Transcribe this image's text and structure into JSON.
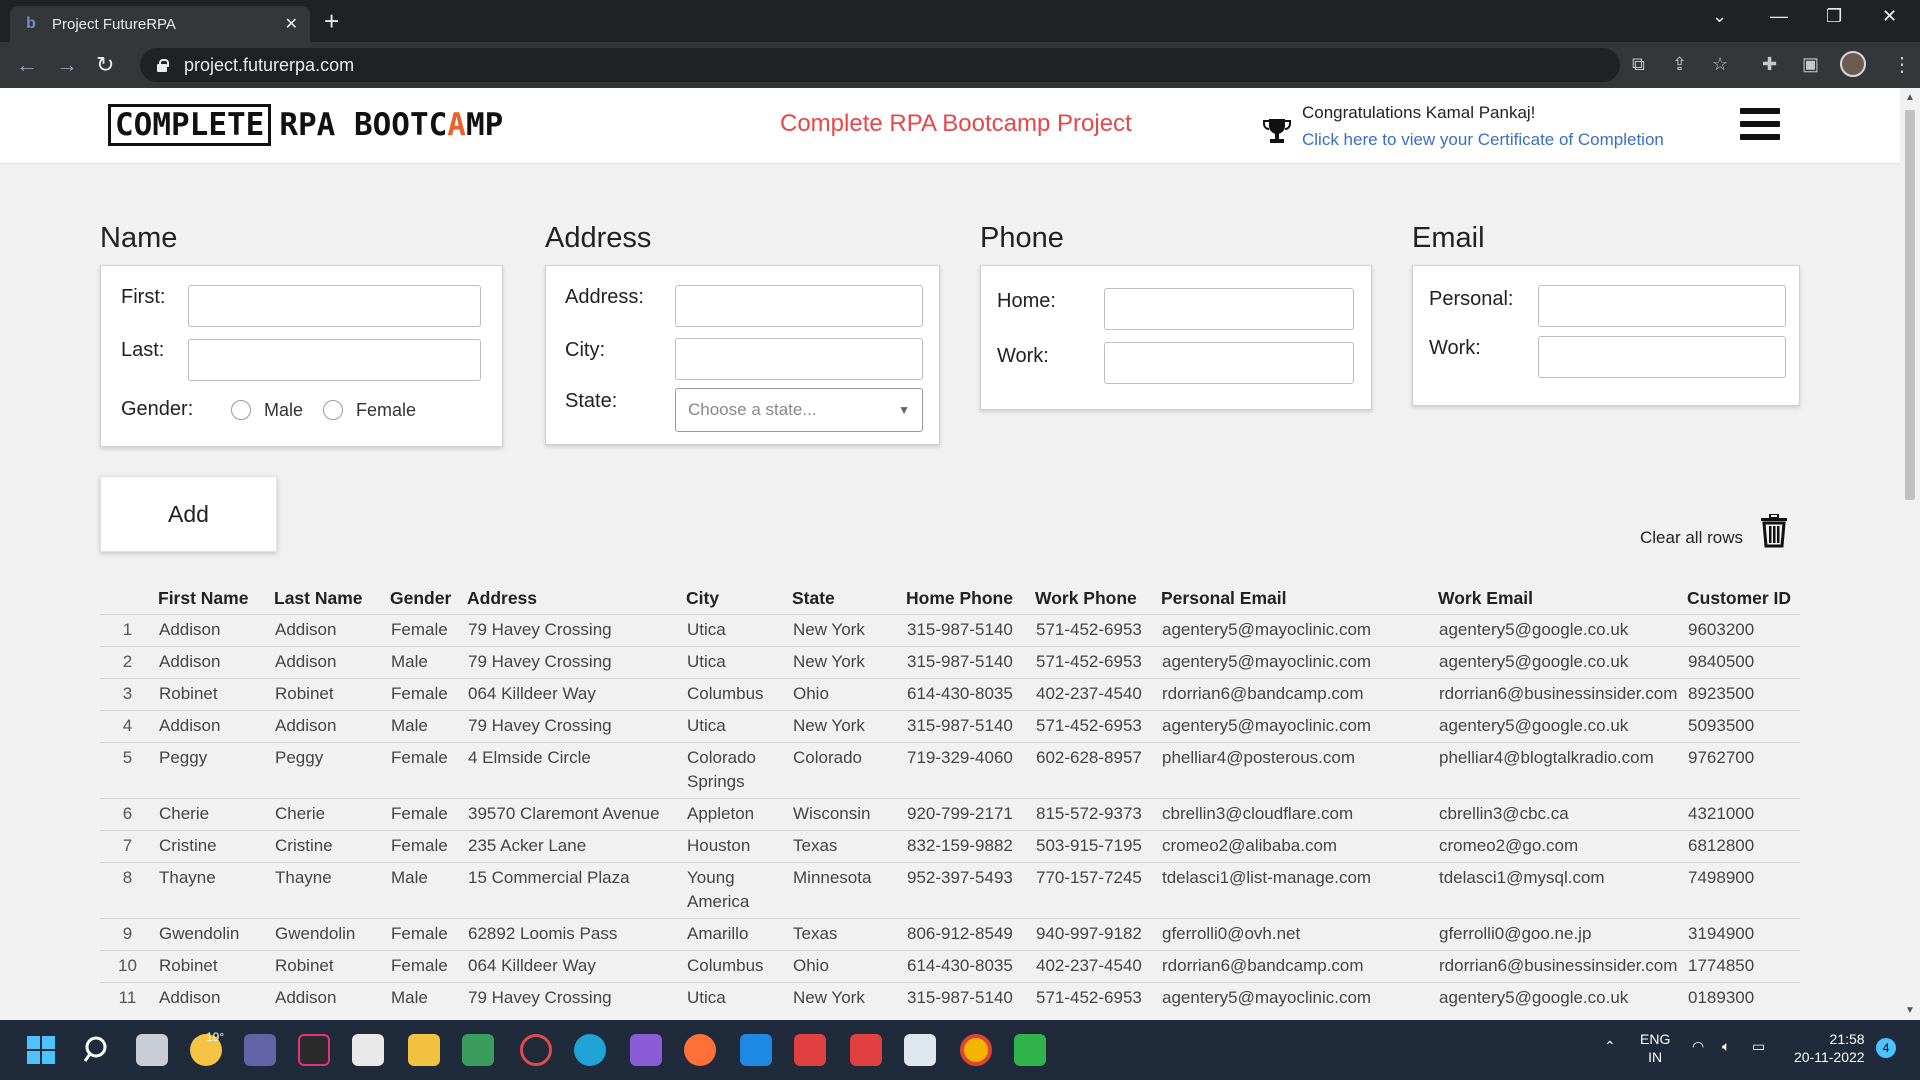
{
  "browser": {
    "tab_title": "Project FutureRPA",
    "url": "project.futurerpa.com"
  },
  "header": {
    "logo_boxed": "COMPLETE",
    "logo_rest_1": "RPA BOOTC",
    "logo_accent": "A",
    "logo_rest_2": "MP",
    "center_title": "Complete RPA Bootcamp Project",
    "congrats": "Congratulations Kamal Pankaj!",
    "cert_link": "Click here to view your Certificate of Completion"
  },
  "form": {
    "name": {
      "title": "Name",
      "first_label": "First:",
      "last_label": "Last:",
      "gender_label": "Gender:",
      "male_label": "Male",
      "female_label": "Female",
      "first_value": "",
      "last_value": ""
    },
    "address": {
      "title": "Address",
      "address_label": "Address:",
      "city_label": "City:",
      "state_label": "State:",
      "state_placeholder": "Choose a state...",
      "address_value": "",
      "city_value": ""
    },
    "phone": {
      "title": "Phone",
      "home_label": "Home:",
      "work_label": "Work:",
      "home_value": "",
      "work_value": ""
    },
    "email": {
      "title": "Email",
      "personal_label": "Personal:",
      "work_label": "Work:",
      "personal_value": "",
      "work_value": ""
    },
    "add_button": "Add",
    "clear_rows": "Clear all rows"
  },
  "table": {
    "columns": [
      "",
      "First Name",
      "Last Name",
      "Gender",
      "Address",
      "City",
      "State",
      "Home Phone",
      "Work Phone",
      "Personal Email",
      "Work Email",
      "Customer ID"
    ],
    "rows": [
      [
        "1",
        "Addison",
        "Addison",
        "Female",
        "79 Havey Crossing",
        "Utica",
        "New York",
        "315-987-5140",
        "571-452-6953",
        "agentery5@mayoclinic.com",
        "agentery5@google.co.uk",
        "9603200"
      ],
      [
        "2",
        "Addison",
        "Addison",
        "Male",
        "79 Havey Crossing",
        "Utica",
        "New York",
        "315-987-5140",
        "571-452-6953",
        "agentery5@mayoclinic.com",
        "agentery5@google.co.uk",
        "9840500"
      ],
      [
        "3",
        "Robinet",
        "Robinet",
        "Female",
        "064 Killdeer Way",
        "Columbus",
        "Ohio",
        "614-430-8035",
        "402-237-4540",
        "rdorrian6@bandcamp.com",
        "rdorrian6@businessinsider.com",
        "8923500"
      ],
      [
        "4",
        "Addison",
        "Addison",
        "Male",
        "79 Havey Crossing",
        "Utica",
        "New York",
        "315-987-5140",
        "571-452-6953",
        "agentery5@mayoclinic.com",
        "agentery5@google.co.uk",
        "5093500"
      ],
      [
        "5",
        "Peggy",
        "Peggy",
        "Female",
        "4 Elmside Circle",
        "Colorado Springs",
        "Colorado",
        "719-329-4060",
        "602-628-8957",
        "phelliar4@posterous.com",
        "phelliar4@blogtalkradio.com",
        "9762700"
      ],
      [
        "6",
        "Cherie",
        "Cherie",
        "Female",
        "39570 Claremont Avenue",
        "Appleton",
        "Wisconsin",
        "920-799-2171",
        "815-572-9373",
        "cbrellin3@cloudflare.com",
        "cbrellin3@cbc.ca",
        "4321000"
      ],
      [
        "7",
        "Cristine",
        "Cristine",
        "Female",
        "235 Acker Lane",
        "Houston",
        "Texas",
        "832-159-9882",
        "503-915-7195",
        "cromeo2@alibaba.com",
        "cromeo2@go.com",
        "6812800"
      ],
      [
        "8",
        "Thayne",
        "Thayne",
        "Male",
        "15 Commercial Plaza",
        "Young America",
        "Minnesota",
        "952-397-5493",
        "770-157-7245",
        "tdelasci1@list-manage.com",
        "tdelasci1@mysql.com",
        "7498900"
      ],
      [
        "9",
        "Gwendolin",
        "Gwendolin",
        "Female",
        "62892 Loomis Pass",
        "Amarillo",
        "Texas",
        "806-912-8549",
        "940-997-9182",
        "gferrolli0@ovh.net",
        "gferrolli0@goo.ne.jp",
        "3194900"
      ],
      [
        "10",
        "Robinet",
        "Robinet",
        "Female",
        "064 Killdeer Way",
        "Columbus",
        "Ohio",
        "614-430-8035",
        "402-237-4540",
        "rdorrian6@bandcamp.com",
        "rdorrian6@businessinsider.com",
        "1774850"
      ],
      [
        "11",
        "Addison",
        "Addison",
        "Male",
        "79 Havey Crossing",
        "Utica",
        "New York",
        "315-987-5140",
        "571-452-6953",
        "agentery5@mayoclinic.com",
        "agentery5@google.co.uk",
        "0189300"
      ]
    ]
  },
  "taskbar": {
    "weather": "19°",
    "lang_top": "ENG",
    "lang_bottom": "IN",
    "time": "21:58",
    "date": "20-11-2022",
    "notification_count": "4"
  },
  "colors": {
    "title_red": "#e8474a",
    "link_blue": "#3a6fc4",
    "logo_orange": "#e8632a"
  }
}
